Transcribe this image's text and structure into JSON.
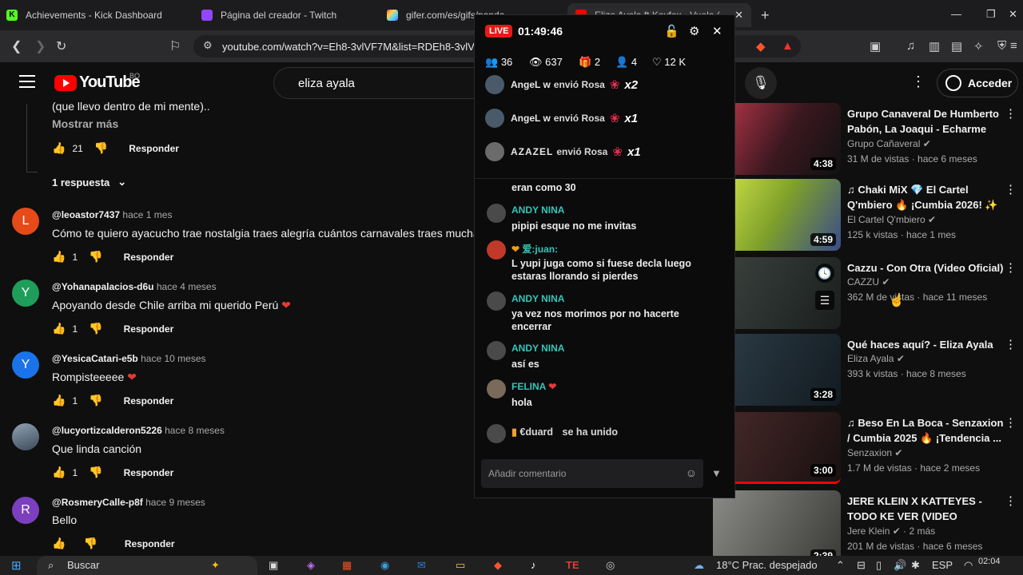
{
  "browser": {
    "tabs": [
      {
        "title": "Achievements - Kick Dashboard"
      },
      {
        "title": "Página del creador - Twitch"
      },
      {
        "title": "gifer.com/es/gifs/panda"
      },
      {
        "title": "Eliza Ayala ft Kayfex - Vuela ("
      }
    ],
    "url": "youtube.com/watch?v=Eh8-3vlVF7M&list=RDEh8-3vlVF7M&start_radio=1",
    "colors": {
      "kick": "#53fc18",
      "twitch": "#9146ff",
      "youtube": "#ff0000"
    }
  },
  "youtube": {
    "logo_text": "YouTube",
    "country_code": "BO",
    "search_value": "eliza ayala",
    "login_label": "Acceder",
    "comments_top": {
      "text_tail": "(que llevo dentro de mi mente)..",
      "show_more": "Mostrar más",
      "likes": "21",
      "reply_label": "Responder",
      "replies_toggle": "1 respuesta"
    },
    "comments": [
      {
        "initial": "L",
        "avatar_color": "#e64a19",
        "author": "@leoastor7437",
        "time": "hace 1 mes",
        "text": "Cómo te quiero ayacucho trae nostalgia traes alegría cuántos carnavales traes muchas emociones",
        "likes": "1",
        "reply": "Responder"
      },
      {
        "initial": "Y",
        "avatar_color": "#1e9e5a",
        "author": "@Yohanapalacios-d6u",
        "time": "hace 4 meses",
        "text": "Apoyando desde Chile arriba mi querido Perú",
        "likes": "1",
        "reply": "Responder"
      },
      {
        "initial": "Y",
        "avatar_color": "#1a73e8",
        "author": "@YesicaCatari-e5b",
        "time": "hace 10 meses",
        "text": "Rompisteeeee",
        "likes": "1",
        "reply": "Responder"
      },
      {
        "initial": "",
        "avatar_color": "#5c6b7a",
        "author": "@lucyortizcalderon5226",
        "time": "hace 8 meses",
        "text": "Que linda canción",
        "likes": "1",
        "reply": "Responder"
      },
      {
        "initial": "R",
        "avatar_color": "#7b3fbf",
        "author": "@RosmeryCalle-p8f",
        "time": "hace 9 meses",
        "text": "Bello",
        "likes": "",
        "reply": "Responder"
      }
    ],
    "sidebar": [
      {
        "title": "Grupo Canaveral De Humberto Pabón, La Joaqui - Echarme Al...",
        "channel": "Grupo Cañaveral",
        "stats": "31 M de vistas · hace 6 meses",
        "duration": "4:38",
        "thumb_color": "#7a2030"
      },
      {
        "title": "♫ Chaki MiX 💎 El Cartel Q'mbiero 🔥 ¡Cumbia 2026! ✨",
        "channel": "El Cartel Q'mbiero",
        "stats": "125 k vistas · hace 1 mes",
        "duration": "4:59",
        "thumb_color": "#b8d43a"
      },
      {
        "title": "Cazzu - Con Otra (Video Oficial)",
        "channel": "CAZZU",
        "stats": "362 M de vistas · hace 11 meses",
        "duration": "",
        "thumb_color": "#2a2f2c"
      },
      {
        "title": "Qué haces aquí? - Eliza Ayala",
        "channel": "Eliza Ayala",
        "stats": "393 k vistas · hace 8 meses",
        "duration": "3:28",
        "thumb_color": "#1e2a33"
      },
      {
        "title": "♫ Beso En La Boca - Senzaxion / Cumbia 2025 🔥 ¡Tendencia ...",
        "channel": "Senzaxion",
        "stats": "1.7 M de vistas · hace 2 meses",
        "duration": "3:00",
        "thumb_color": "#3a2424"
      },
      {
        "title": "JERE KLEIN X KATTEYES - TODO KE VER (VIDEO OFICIAL)",
        "channel": "Jere Klein",
        "stats": "201 M de vistas · hace 6 meses",
        "duration": "2:39",
        "thumb_color": "#6b6a66",
        "extra": "2 más"
      }
    ]
  },
  "kick_overlay": {
    "live_label": "LIVE",
    "timer": "01:49:46",
    "stats": {
      "people": "36",
      "viewers": "637",
      "gifts": "2",
      "followers": "4",
      "likes": "12 K"
    },
    "gifts": [
      {
        "name": "AngeL w",
        "action": "envió Rosa",
        "count": "x2"
      },
      {
        "name": "AngeL w",
        "action": "envió Rosa",
        "count": "x1"
      },
      {
        "name": "AZAZEL",
        "action": "envió Rosa",
        "count": "x1"
      }
    ],
    "messages": [
      {
        "user": "",
        "text": "eran como 30"
      },
      {
        "user": "ANDY NINA",
        "text": "pipipi esque no me invitas"
      },
      {
        "user": "爱:juan:",
        "text": "L yupi juga como si fuese decla luego estaras llorando si pierdes"
      },
      {
        "user": "ANDY NINA",
        "text": "ya vez nos morimos por no hacerte encerrar"
      },
      {
        "user": "ANDY NINA",
        "text": "así es"
      },
      {
        "user": "FELINA",
        "text": "hola"
      }
    ],
    "join_notice": {
      "user": "€duard",
      "text": "se ha unido"
    },
    "input_placeholder": "Añadir comentario"
  },
  "taskbar": {
    "search_label": "Buscar",
    "weather": "18°C Prac. despejado",
    "language": "ESP",
    "time": "02:04"
  }
}
